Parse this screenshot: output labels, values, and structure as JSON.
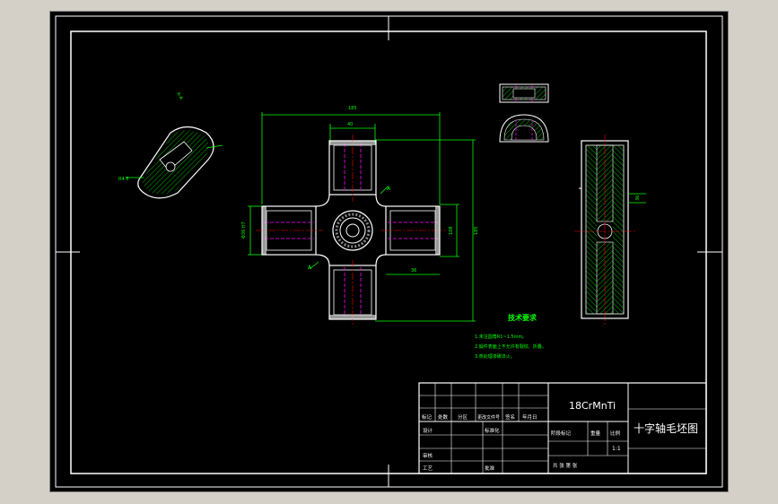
{
  "drawing": {
    "title": "十字轴毛坯图",
    "material": "18CrMnTi",
    "scale": "1:1"
  },
  "technical_requirements": {
    "heading": "技术要求",
    "items": [
      "1.未注圆角R1~1.5mm。",
      "2.锻件表面上不允许有裂纹、折叠。",
      "3.热处理渗碳淬火。"
    ]
  },
  "title_block": {
    "row_labels": [
      "标记",
      "处数",
      "分区",
      "更改文件号",
      "签名",
      "年月日"
    ],
    "designer": "设计",
    "standardization": "标准化",
    "checker": "审核",
    "process": "工艺",
    "approve": "批准",
    "stage_marks": "阶段标记",
    "weight": "重量",
    "scale_label": "比例",
    "sheet_info": "共 张 第 张"
  },
  "dimension_labels": {
    "overall_width": "185",
    "arm_width": "40",
    "height": "185",
    "inner_height": "108",
    "left_dim": "Φ36 H7",
    "arm_len": "36",
    "right_dim": "36",
    "section_label": "A",
    "detail_label": "A-A",
    "detail_dim": "R4.5"
  }
}
